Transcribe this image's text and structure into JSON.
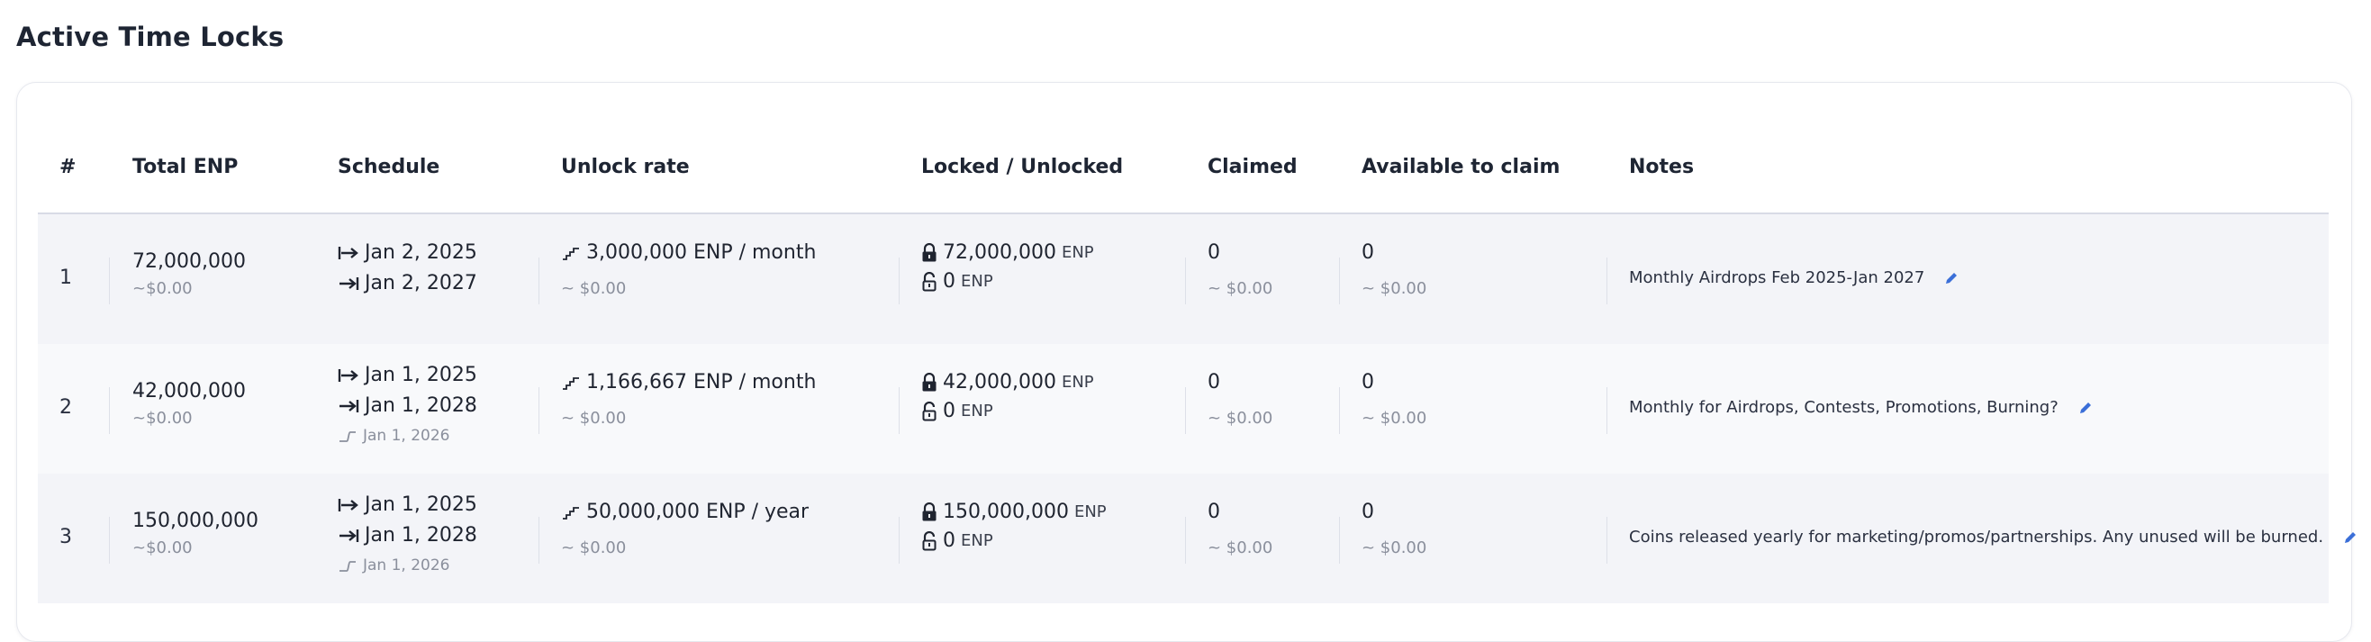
{
  "page": {
    "title": "Active Time Locks"
  },
  "table": {
    "columns": [
      "#",
      "Total ENP",
      "Schedule",
      "Unlock rate",
      "Locked / Unlocked",
      "Claimed",
      "Available to claim",
      "Notes"
    ],
    "rows": [
      {
        "index": "1",
        "total": "72,000,000",
        "total_usd": "~$0.00",
        "start": "Jan 2, 2025",
        "end": "Jan 2, 2027",
        "cliff": "",
        "rate": "3,000,000 ENP / month",
        "rate_usd": "~ $0.00",
        "locked": "72,000,000",
        "locked_unit": "ENP",
        "unlocked": "0",
        "unlocked_unit": "ENP",
        "claimed": "0",
        "claimed_usd": "~ $0.00",
        "available": "0",
        "available_usd": "~ $0.00",
        "notes": "Monthly Airdrops Feb 2025-Jan 2027"
      },
      {
        "index": "2",
        "total": "42,000,000",
        "total_usd": "~$0.00",
        "start": "Jan 1, 2025",
        "end": "Jan 1, 2028",
        "cliff": "Jan 1, 2026",
        "rate": "1,166,667 ENP / month",
        "rate_usd": "~ $0.00",
        "locked": "42,000,000",
        "locked_unit": "ENP",
        "unlocked": "0",
        "unlocked_unit": "ENP",
        "claimed": "0",
        "claimed_usd": "~ $0.00",
        "available": "0",
        "available_usd": "~ $0.00",
        "notes": "Monthly for Airdrops, Contests, Promotions, Burning?"
      },
      {
        "index": "3",
        "total": "150,000,000",
        "total_usd": "~$0.00",
        "start": "Jan 1, 2025",
        "end": "Jan 1, 2028",
        "cliff": "Jan 1, 2026",
        "rate": "50,000,000 ENP / year",
        "rate_usd": "~ $0.00",
        "locked": "150,000,000",
        "locked_unit": "ENP",
        "unlocked": "0",
        "unlocked_unit": "ENP",
        "claimed": "0",
        "claimed_usd": "~ $0.00",
        "available": "0",
        "available_usd": "~ $0.00",
        "notes": "Coins released yearly for marketing/promos/partnerships. Any unused will be burned."
      }
    ]
  },
  "icons": {
    "start": "arrow-from-bar-icon",
    "end": "arrow-to-bar-icon",
    "cliff": "cliff-step-icon",
    "rate": "staircase-icon",
    "locked": "lock-closed-icon",
    "unlocked": "lock-open-icon",
    "edit": "pencil-icon"
  },
  "colors": {
    "accent": "#3b6fd8",
    "row_shade": "#f3f4f8",
    "row_light": "#f8f9fb"
  }
}
